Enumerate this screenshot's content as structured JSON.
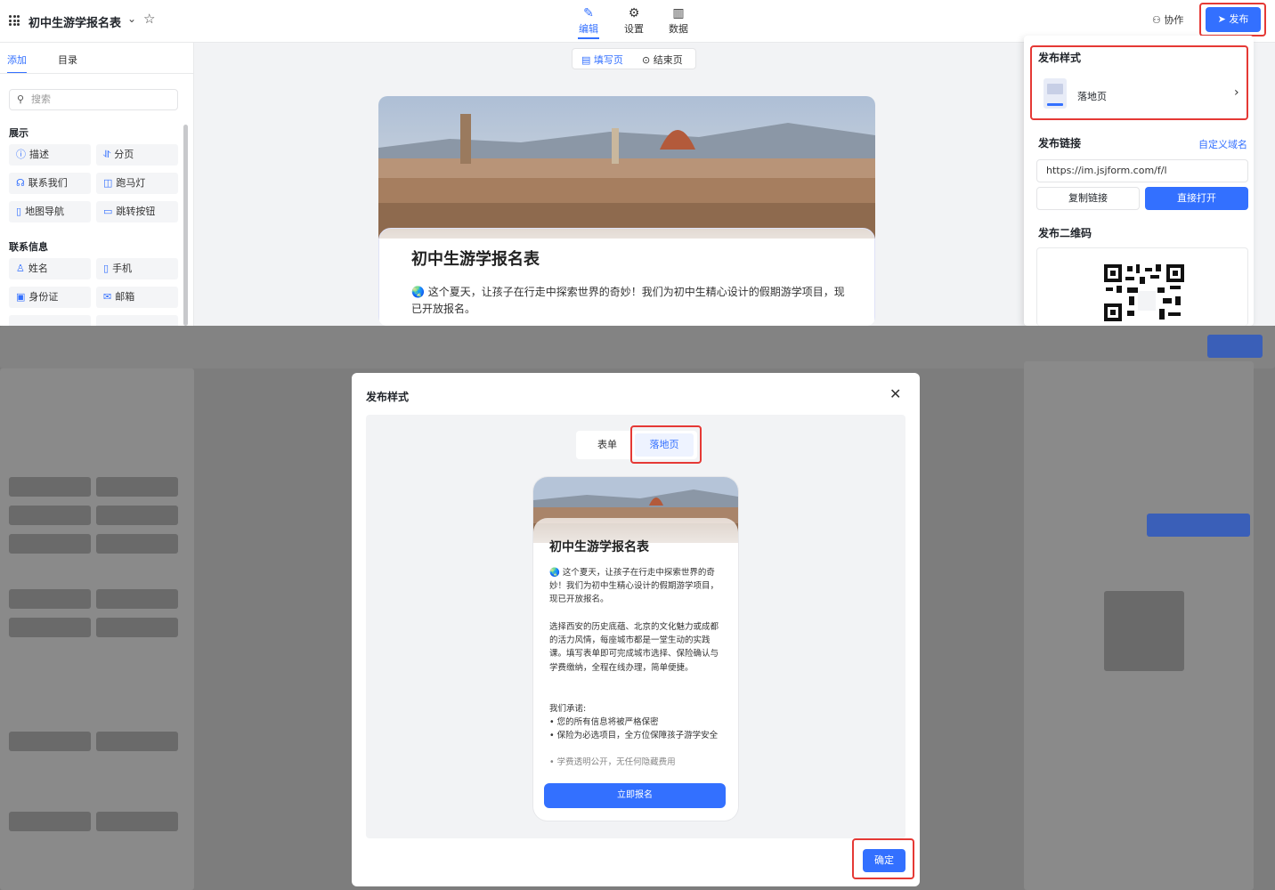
{
  "editor": {
    "form_title": "初中生游学报名表",
    "mode_tabs": [
      {
        "label": "编辑",
        "icon": "pencil-icon"
      },
      {
        "label": "设置",
        "icon": "gear-icon"
      },
      {
        "label": "数据",
        "icon": "bar-chart-icon"
      }
    ],
    "collab_label": "协作",
    "publish_label": "发布",
    "left_tabs": [
      "添加",
      "目录"
    ],
    "search_placeholder": "搜索",
    "sections": [
      {
        "title": "展示",
        "items": [
          "描述",
          "分页",
          "联系我们",
          "跑马灯",
          "地图导航",
          "跳转按钮"
        ]
      },
      {
        "title": "联系信息",
        "items": [
          "姓名",
          "手机",
          "身份证",
          "邮箱"
        ]
      }
    ],
    "page_tabs": [
      "填写页",
      "结束页"
    ],
    "form_heading": "初中生游学报名表",
    "form_intro": "🌏 这个夏天，让孩子在行走中探索世界的奇妙！我们为初中生精心设计的假期游学项目，现已开放报名。",
    "publish_panel": {
      "style_title": "发布样式",
      "style_value": "落地页",
      "link_title": "发布链接",
      "custom_domain": "自定义域名",
      "link_value": "https://im.jsjform.com/f/l",
      "copy_label": "复制链接",
      "open_label": "直接打开",
      "qr_title": "发布二维码"
    }
  },
  "modal": {
    "title": "发布样式",
    "tabs": [
      "表单",
      "落地页"
    ],
    "active_tab": "落地页",
    "preview": {
      "heading": "初中生游学报名表",
      "para1": "🌏 这个夏天，让孩子在行走中探索世界的奇妙！我们为初中生精心设计的假期游学项目，现已开放报名。",
      "para2": "选择西安的历史底蕴、北京的文化魅力或成都的活力风情，每座城市都是一堂生动的实践课。填写表单即可完成城市选择、保险确认与学费缴纳，全程在线办理，简单便捷。",
      "promise_title": "我们承诺:",
      "promises": [
        "• 您的所有信息将被严格保密",
        "• 保险为必选项目，全方位保障孩子游学安全",
        "• 学费透明公开，无任何隐藏费用"
      ],
      "cta": "立即报名"
    },
    "confirm_label": "确定"
  },
  "colors": {
    "accent": "#3370ff",
    "highlight": "#e53935"
  }
}
